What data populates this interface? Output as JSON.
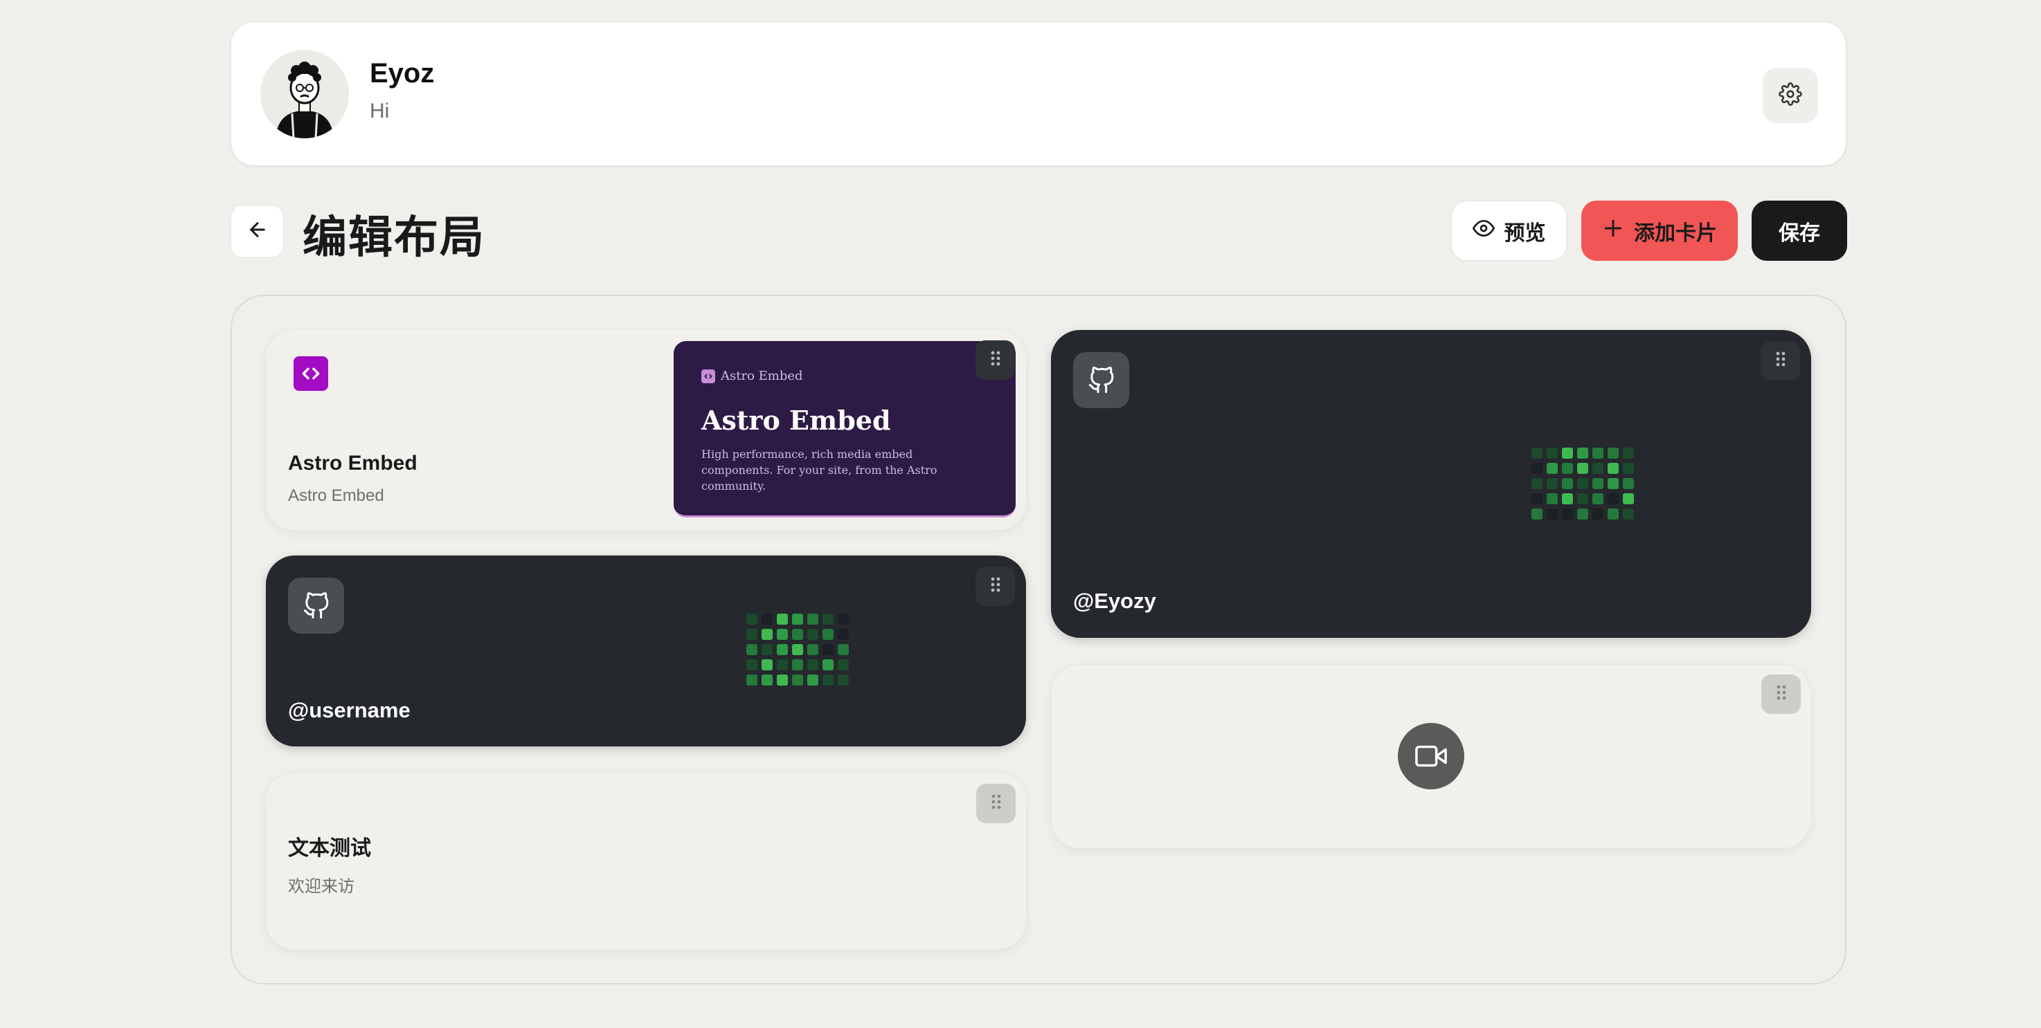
{
  "profile": {
    "name": "Eyoz",
    "bio": "Hi",
    "icons": {
      "settings": "gear-icon"
    }
  },
  "toolbar": {
    "title": "编辑布局",
    "preview_label": "预览",
    "add_card_label": "添加卡片",
    "save_label": "保存",
    "icons": {
      "back": "arrow-left-icon",
      "preview": "eye-icon",
      "add": "plus-icon"
    }
  },
  "colors": {
    "accent_red": "#f25555",
    "dark_button": "#1a1a1a",
    "card_dark": "#25282d",
    "astro_purple": "#2d1b45",
    "astro_logo": "#a30bc4",
    "contrib_green": "#3fba50"
  },
  "cards": {
    "astro": {
      "title": "Astro Embed",
      "subtitle": "Astro Embed",
      "preview_brand": "Astro Embed",
      "preview_heading": "Astro Embed",
      "preview_description": "High performance, rich media embed components. For your site, from the Astro community.",
      "icon": "code-icon"
    },
    "github_user": {
      "handle": "@username",
      "icon": "github-icon"
    },
    "text": {
      "title": "文本测试",
      "subtitle": "欢迎来访"
    },
    "github_eyozy": {
      "handle": "@Eyozy",
      "icon": "github-icon"
    },
    "video": {
      "icon": "video-camera-icon"
    }
  }
}
